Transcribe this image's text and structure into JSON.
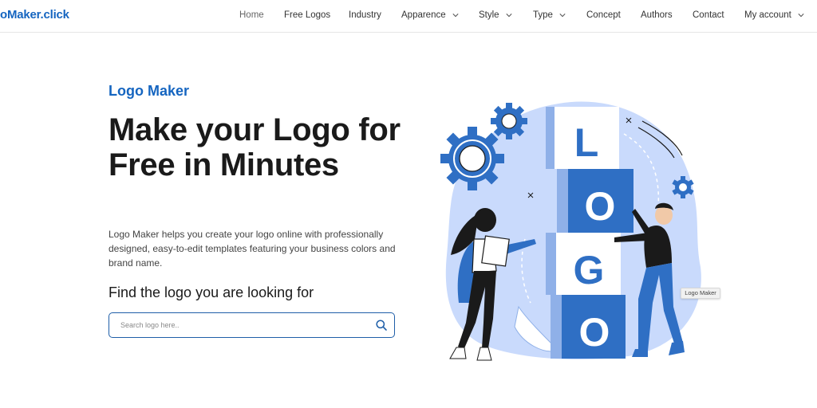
{
  "header": {
    "site_logo": "oMaker.click",
    "nav": [
      {
        "label": "Home",
        "active": true,
        "dropdown": false
      },
      {
        "label": "Free Logos",
        "dropdown": false
      },
      {
        "label": "Industry",
        "dropdown": false
      },
      {
        "label": "Apparence",
        "dropdown": true
      },
      {
        "label": "Style",
        "dropdown": true
      },
      {
        "label": "Type",
        "dropdown": true
      },
      {
        "label": "Concept",
        "dropdown": false
      },
      {
        "label": "Authors",
        "dropdown": false
      },
      {
        "label": "Contact",
        "dropdown": false
      },
      {
        "label": "My account",
        "dropdown": true
      }
    ]
  },
  "hero": {
    "eyebrow": "Logo Maker",
    "headline": "Make your Logo for Free in Minutes",
    "description": "Logo Maker helps you create your logo online with professionally designed, easy-to-edit templates featuring your business colors and brand name.",
    "find_heading": "Find the logo you are looking for",
    "search": {
      "placeholder": "Search logo here..",
      "value": ""
    }
  },
  "illustration": {
    "letters": [
      "L",
      "O",
      "G",
      "O"
    ],
    "tooltip": "Logo Maker"
  },
  "colors": {
    "accent": "#1565c0",
    "blob": "#c9dafc",
    "block_blue": "#2f6fc4",
    "block_light": "#8fb0e8"
  }
}
